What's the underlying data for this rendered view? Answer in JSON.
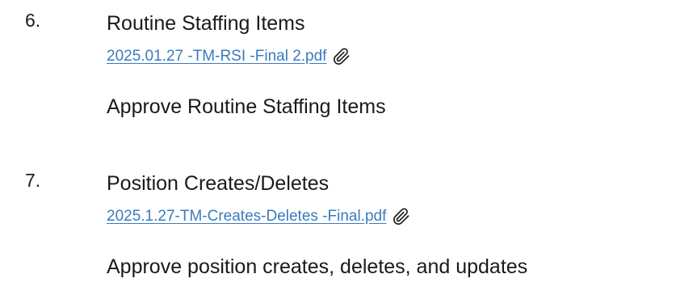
{
  "items": [
    {
      "number": "6.",
      "title": "Routine Staffing Items",
      "attachment": "2025.01.27 -TM-RSI -Final 2.pdf",
      "motion": "Approve Routine Staffing Items"
    },
    {
      "number": "7.",
      "title": "Position Creates/Deletes",
      "attachment": "2025.1.27-TM-Creates-Deletes -Final.pdf",
      "motion": "Approve position creates, deletes, and updates"
    }
  ],
  "colors": {
    "link": "#3a7bbf",
    "text": "#1a1a1a"
  },
  "icons": {
    "attachment": "paperclip-icon"
  }
}
